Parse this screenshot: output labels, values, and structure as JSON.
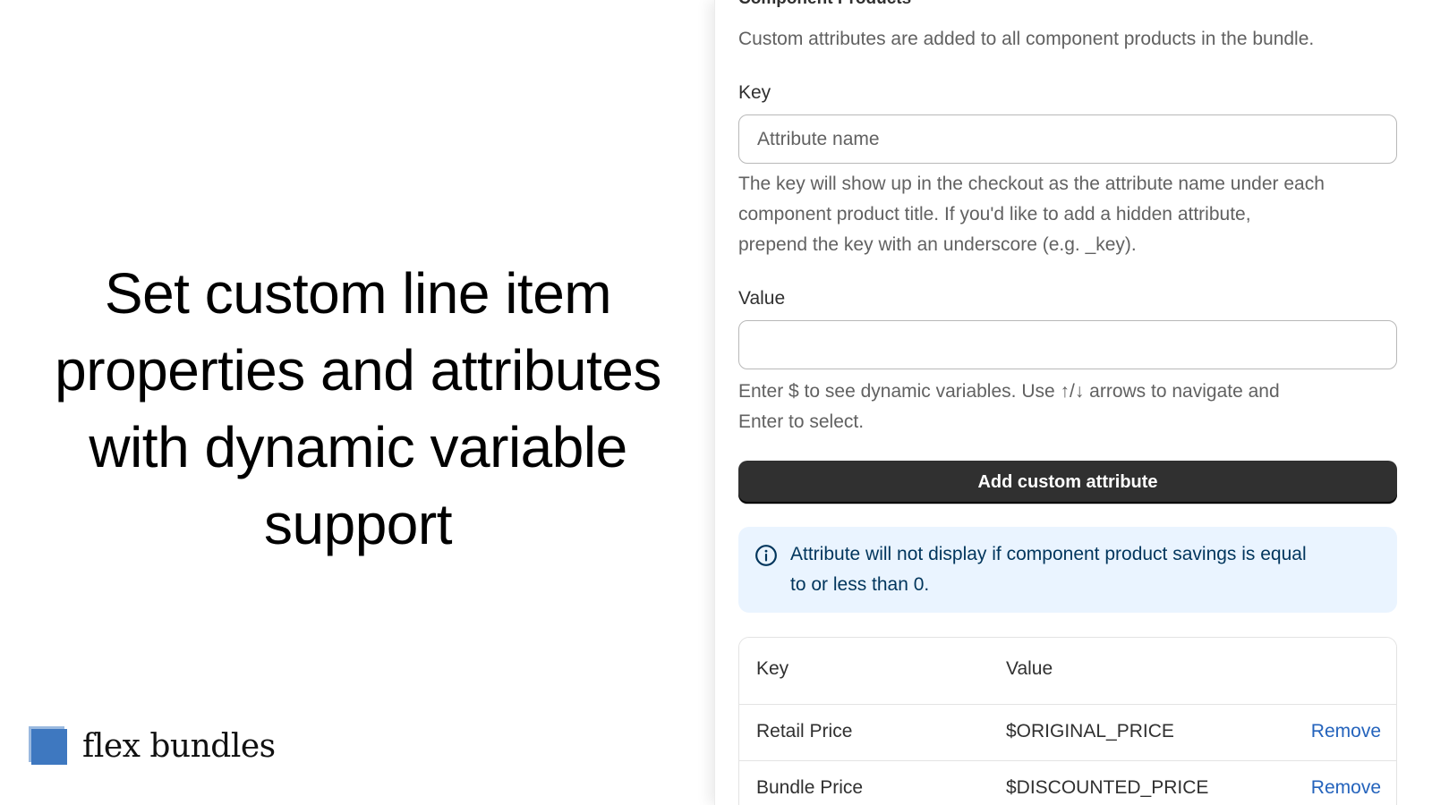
{
  "promo": {
    "headline_lines": [
      "Set custom line item",
      "properties and attributes",
      "with dynamic variable",
      "support"
    ],
    "brand_name": "flex bundles",
    "brand_color": "#3e78c0"
  },
  "form": {
    "section_title": "Component Products",
    "section_description": "Custom attributes are added to all component products in the bundle.",
    "key_label": "Key",
    "key_placeholder": "Attribute name",
    "key_value": "",
    "key_help_lines": [
      "The key will show up in the checkout as the attribute name under each",
      "component product title. If you'd like to add a hidden attribute,",
      "prepend the key with an underscore (e.g. _key)."
    ],
    "value_label": "Value",
    "value_value": "",
    "value_help_lines": [
      "Enter $ to see dynamic variables. Use ↑/↓ arrows to navigate and",
      "Enter to select."
    ],
    "add_button_label": "Add custom attribute",
    "button_color": "#303030"
  },
  "info_banner": {
    "icon": "info-circle-icon",
    "text_lines": [
      "Attribute will not display if component product savings is equal",
      "to or less than 0."
    ],
    "background": "#eaf4ff"
  },
  "attributes_table": {
    "headers": [
      "Key",
      "Value",
      ""
    ],
    "rows": [
      {
        "key": "Retail Price",
        "value": "$ORIGINAL_PRICE",
        "action": "Remove"
      },
      {
        "key": "Bundle Price",
        "value": "$DISCOUNTED_PRICE",
        "action": "Remove"
      }
    ],
    "link_color": "#2463bc"
  }
}
